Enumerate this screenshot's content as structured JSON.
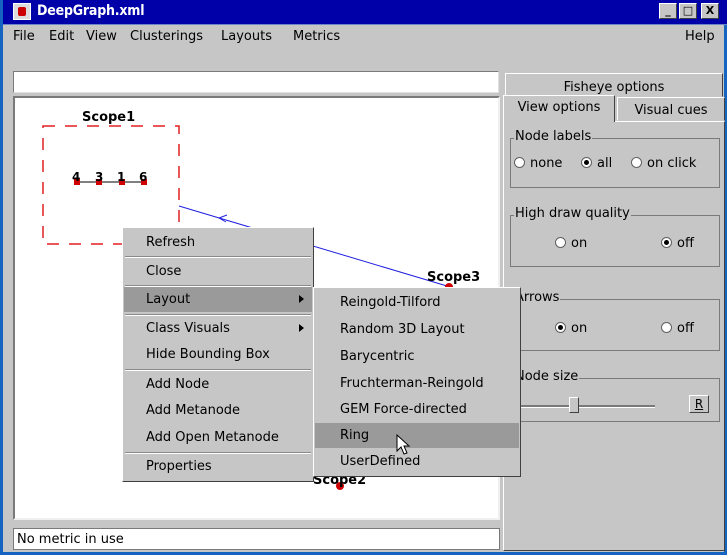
{
  "window": {
    "title": "DeepGraph.xml",
    "minimize": "_",
    "maximize": "□",
    "close": "X"
  },
  "menu": {
    "file": "File",
    "edit": "Edit",
    "view": "View",
    "clusterings": "Clusterings",
    "layouts": "Layouts",
    "metrics": "Metrics",
    "help": "Help"
  },
  "address_value": "",
  "graph": {
    "scope1": "Scope1",
    "scope2": "Scope2",
    "scope3": "Scope3",
    "nodes": [
      "4",
      "3",
      "1",
      "6"
    ]
  },
  "status": "No metric in use",
  "tabs": {
    "fisheye": "Fisheye options",
    "view": "View options",
    "visual": "Visual cues"
  },
  "options": {
    "node_labels": {
      "label": "Node labels",
      "none": "none",
      "all": "all",
      "on_click": "on click",
      "selected": "all"
    },
    "high_draw_quality": {
      "label": "High draw quality",
      "on": "on",
      "off": "off",
      "selected": "off"
    },
    "arrows": {
      "label": "Arrows",
      "on": "on",
      "off": "off",
      "selected": "on"
    },
    "node_size": {
      "label": "Node size",
      "reset": "R",
      "value": 0.45
    }
  },
  "context_menu": {
    "items": [
      "Refresh",
      "Close",
      "Layout",
      "Class Visuals",
      "Hide Bounding Box",
      "Add Node",
      "Add Metanode",
      "Add Open Metanode",
      "Properties"
    ]
  },
  "layout_submenu": {
    "items": [
      "Reingold-Tilford",
      "Random 3D Layout",
      "Barycentric",
      "Fruchterman-Reingold",
      "GEM Force-directed",
      "Ring",
      "UserDefined"
    ],
    "highlighted": "Ring"
  }
}
